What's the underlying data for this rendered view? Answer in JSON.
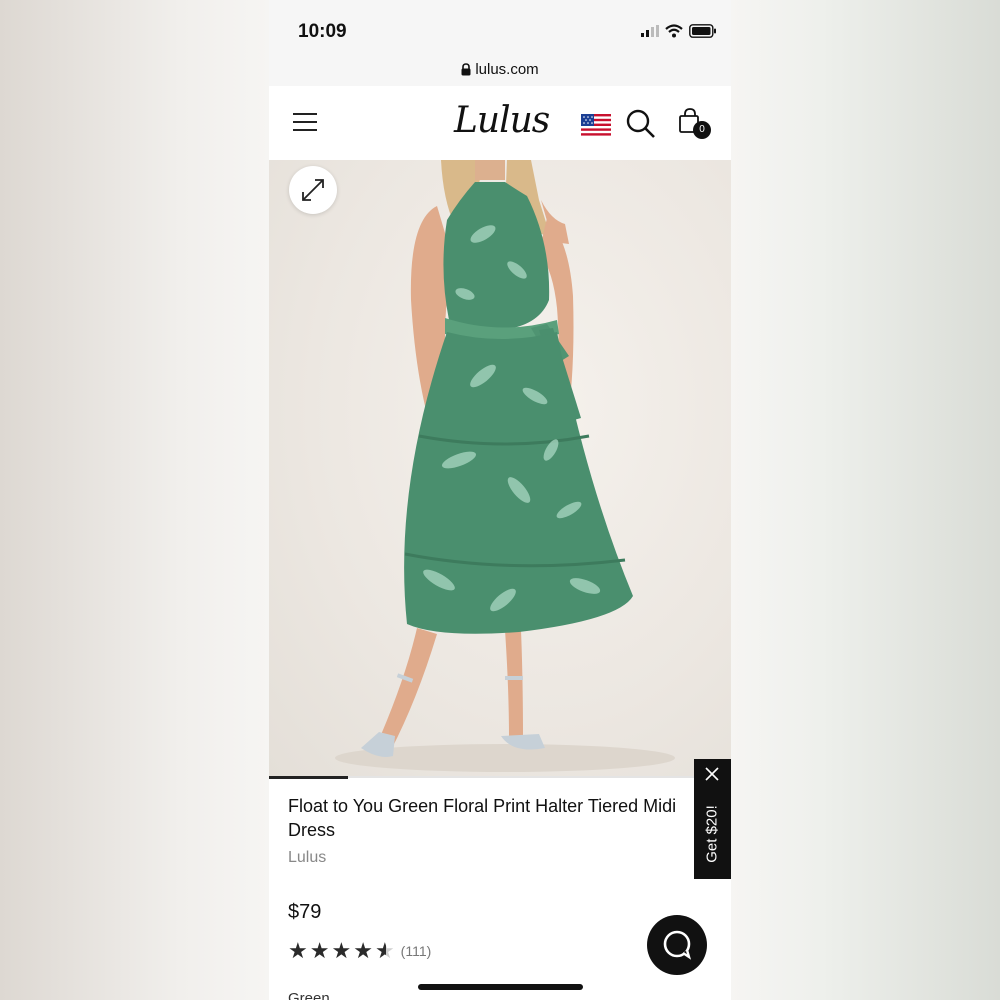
{
  "status_bar": {
    "time": "10:09",
    "icons": [
      "signal-icon",
      "wifi-icon",
      "battery-icon"
    ]
  },
  "browser": {
    "url": "lulus.com",
    "lock_icon": "lock-icon"
  },
  "header": {
    "menu_icon": "hamburger-menu-icon",
    "logo": "Lulus",
    "flag_icon": "us-flag-icon",
    "search_icon": "search-icon",
    "bag_icon": "shopping-bag-icon",
    "bag_count": "0"
  },
  "gallery": {
    "expand_icon": "expand-icon",
    "image_progress": 0.17
  },
  "product": {
    "title": "Float to You Green Floral Print Halter Tiered Midi Dress",
    "brand": "Lulus",
    "price": "$79",
    "rating": 4.5,
    "review_count": "(111)",
    "color_label": "Green"
  },
  "promo": {
    "label": "Get $20!",
    "close_icon": "close-icon"
  },
  "chat": {
    "icon": "chat-icon"
  },
  "colors": {
    "dress_green": "#4a8f6e",
    "background": "#ece7e1",
    "text": "#111111",
    "muted": "#888888"
  }
}
